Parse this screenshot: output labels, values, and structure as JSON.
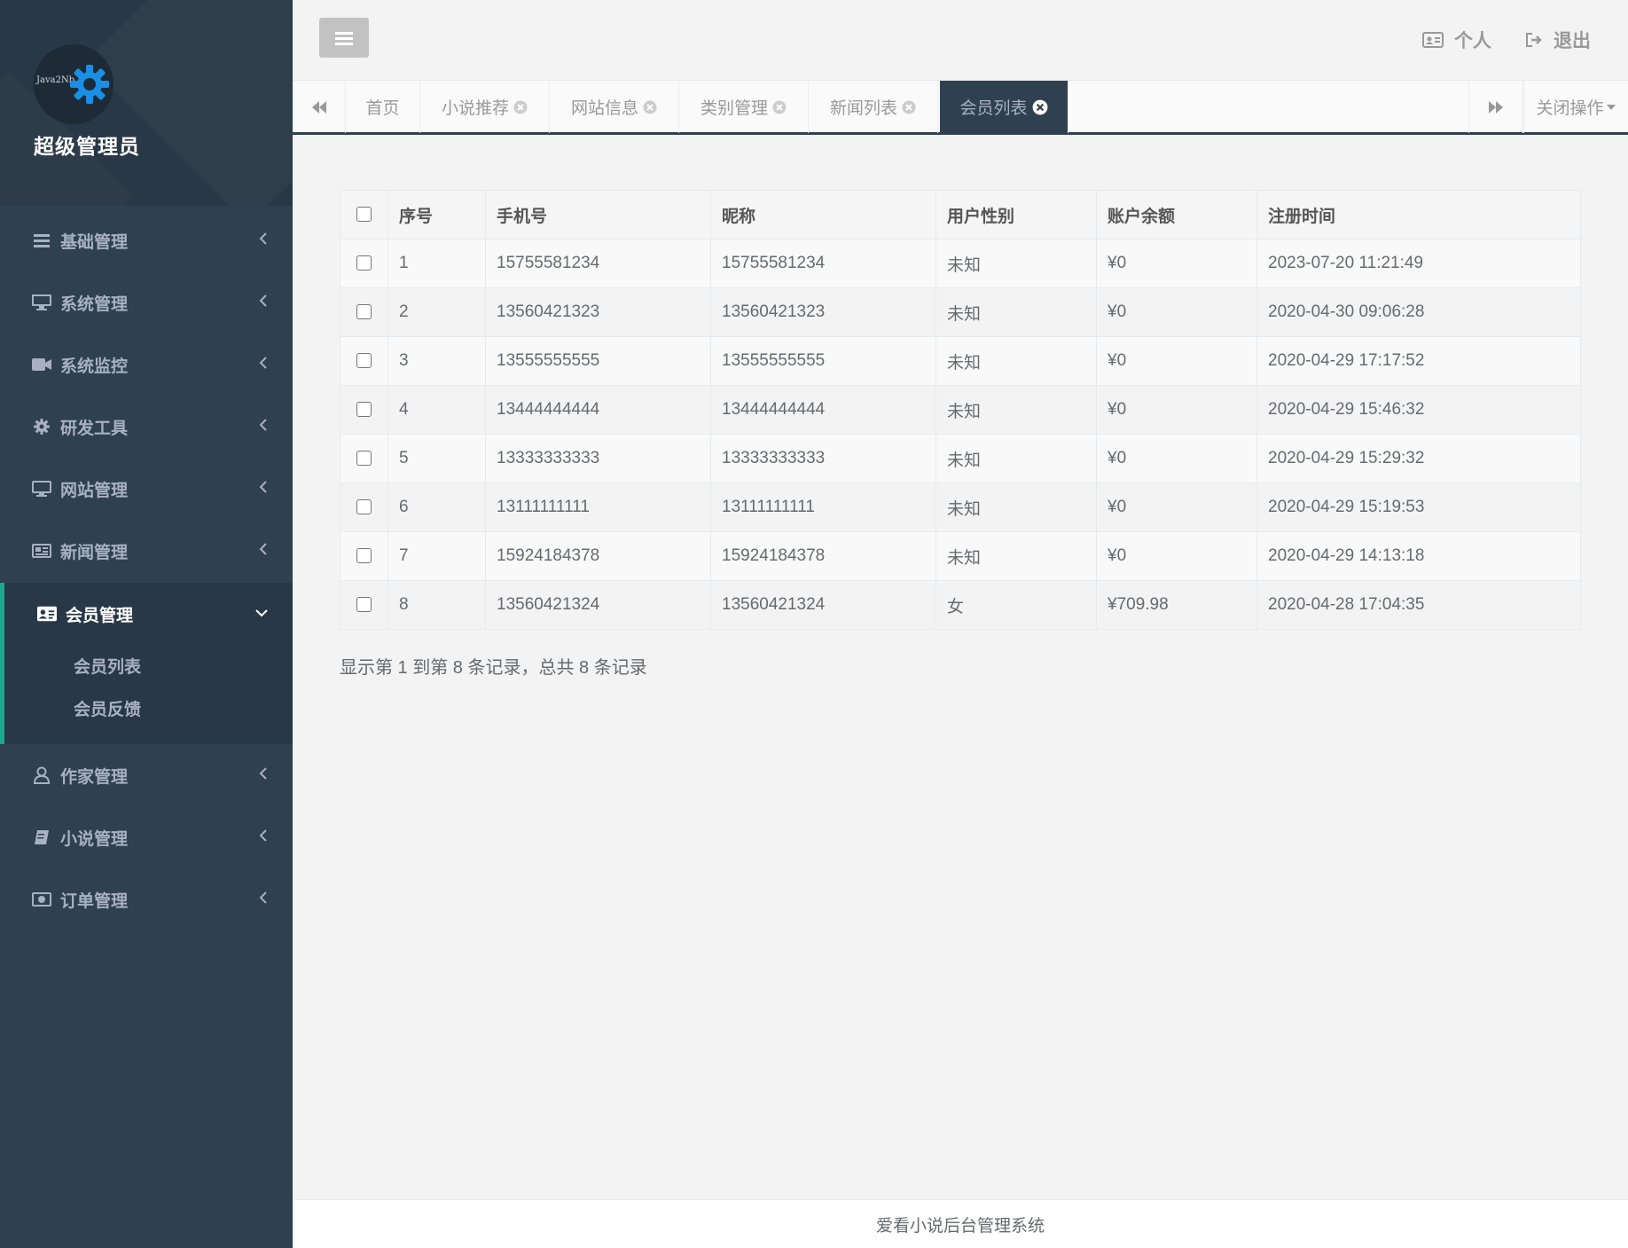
{
  "sidebar": {
    "logo_text": "Java2Nb",
    "admin_name": "超级管理员",
    "items": [
      {
        "label": "基础管理"
      },
      {
        "label": "系统管理"
      },
      {
        "label": "系统监控"
      },
      {
        "label": "研发工具"
      },
      {
        "label": "网站管理"
      },
      {
        "label": "新闻管理"
      },
      {
        "label": "会员管理"
      },
      {
        "label": "作家管理"
      },
      {
        "label": "小说管理"
      },
      {
        "label": "订单管理"
      }
    ],
    "subitems": [
      {
        "label": "会员列表"
      },
      {
        "label": "会员反馈"
      }
    ],
    "accent_color": "#19aa8d"
  },
  "topbar": {
    "profile_label": "个人",
    "logout_label": "退出"
  },
  "tabs": {
    "items": [
      {
        "label": "首页"
      },
      {
        "label": "小说推荐"
      },
      {
        "label": "网站信息"
      },
      {
        "label": "类别管理"
      },
      {
        "label": "新闻列表"
      },
      {
        "label": "会员列表"
      }
    ],
    "active": "会员列表",
    "close_ops_label": "关闭操作"
  },
  "table": {
    "columns": [
      "序号",
      "手机号",
      "昵称",
      "用户性别",
      "账户余额",
      "注册时间"
    ],
    "rows": [
      [
        "1",
        "15755581234",
        "15755581234",
        "未知",
        "¥0",
        "2023-07-20 11:21:49"
      ],
      [
        "2",
        "13560421323",
        "13560421323",
        "未知",
        "¥0",
        "2020-04-30 09:06:28"
      ],
      [
        "3",
        "13555555555",
        "13555555555",
        "未知",
        "¥0",
        "2020-04-29 17:17:52"
      ],
      [
        "4",
        "13444444444",
        "13444444444",
        "未知",
        "¥0",
        "2020-04-29 15:46:32"
      ],
      [
        "5",
        "13333333333",
        "13333333333",
        "未知",
        "¥0",
        "2020-04-29 15:29:32"
      ],
      [
        "6",
        "13111111111",
        "13111111111",
        "未知",
        "¥0",
        "2020-04-29 15:19:53"
      ],
      [
        "7",
        "15924184378",
        "15924184378",
        "未知",
        "¥0",
        "2020-04-29 14:13:18"
      ],
      [
        "8",
        "13560421324",
        "13560421324",
        "女",
        "¥709.98",
        "2020-04-28 17:04:35"
      ]
    ],
    "summary": "显示第 1 到第 8 条记录，总共 8 条记录"
  },
  "footer": {
    "text": "爱看小说后台管理系统"
  }
}
